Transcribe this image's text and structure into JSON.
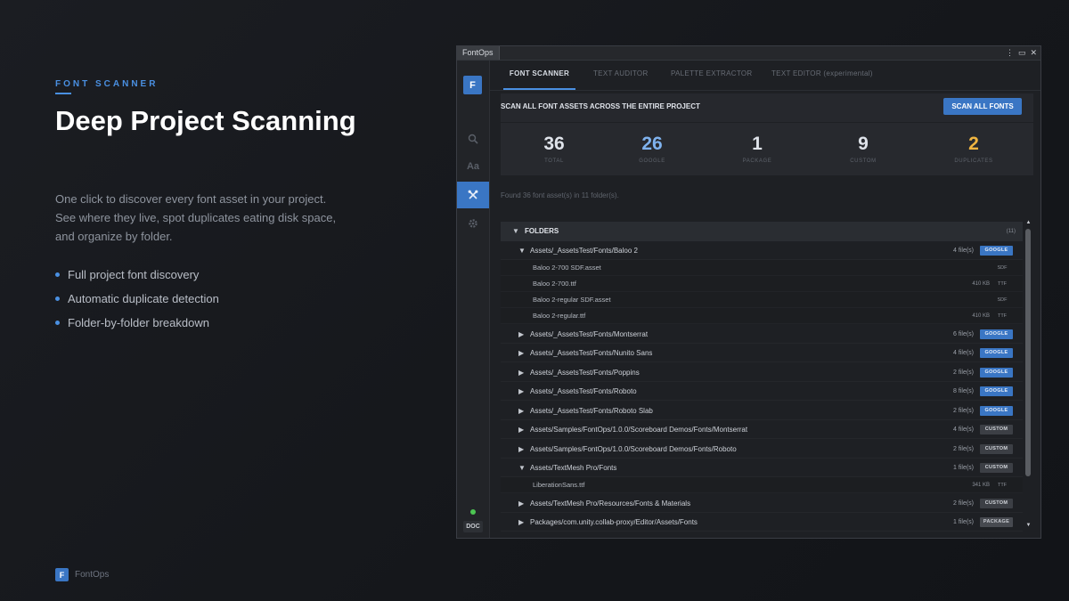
{
  "hero": {
    "eyebrow": "FONT SCANNER",
    "headline": "Deep Project Scanning",
    "description": "One click to discover every font asset in your project. See where they live, spot duplicates eating disk space, and organize by folder.",
    "bullets": [
      "Full project font discovery",
      "Automatic duplicate detection",
      "Folder-by-folder breakdown"
    ]
  },
  "brand": {
    "logo_letter": "F",
    "name": "FontOps"
  },
  "window": {
    "tab_title": "FontOps",
    "controls": [
      "⋮",
      "▭",
      "✕"
    ]
  },
  "sidebar": {
    "logo_letter": "F",
    "icons": [
      "search-icon",
      "text-style-icon",
      "tools-icon",
      "gear-icon"
    ],
    "text_icon_label": "Aa",
    "doc_label": "DOC"
  },
  "tabs": [
    "FONT SCANNER",
    "TEXT AUDITOR",
    "PALETTE EXTRACTOR",
    "TEXT EDITOR (experimental)"
  ],
  "scan": {
    "label": "SCAN ALL FONT ASSETS ACROSS THE ENTIRE PROJECT",
    "button": "SCAN ALL FONTS"
  },
  "stats": [
    {
      "value": "36",
      "label": "TOTAL",
      "color": "#dfe3ea"
    },
    {
      "value": "26",
      "label": "GOOGLE",
      "color": "#7fb2ee"
    },
    {
      "value": "1",
      "label": "PACKAGE",
      "color": "#dfe3ea"
    },
    {
      "value": "9",
      "label": "CUSTOM",
      "color": "#dfe3ea"
    },
    {
      "value": "2",
      "label": "DUPLICATES",
      "color": "#f0b541"
    }
  ],
  "found_text": "Found 36 font asset(s) in 11 folder(s).",
  "folders": {
    "header": "FOLDERS",
    "count": "(11)",
    "rows": [
      {
        "kind": "folder",
        "expanded": true,
        "path": "Assets/_AssetsTest/Fonts/Baloo 2",
        "count": "4 file(s)",
        "badge": "GOOGLE"
      },
      {
        "kind": "file",
        "name": "Baloo 2-700 SDF.asset",
        "size": "",
        "type": "SDF"
      },
      {
        "kind": "file",
        "name": "Baloo 2-700.ttf",
        "size": "410 KB",
        "type": "TTF"
      },
      {
        "kind": "file",
        "name": "Baloo 2-regular SDF.asset",
        "size": "",
        "type": "SDF"
      },
      {
        "kind": "file",
        "name": "Baloo 2-regular.ttf",
        "size": "410 KB",
        "type": "TTF"
      },
      {
        "kind": "folder",
        "expanded": false,
        "path": "Assets/_AssetsTest/Fonts/Montserrat",
        "count": "6 file(s)",
        "badge": "GOOGLE"
      },
      {
        "kind": "folder",
        "expanded": false,
        "path": "Assets/_AssetsTest/Fonts/Nunito Sans",
        "count": "4 file(s)",
        "badge": "GOOGLE"
      },
      {
        "kind": "folder",
        "expanded": false,
        "path": "Assets/_AssetsTest/Fonts/Poppins",
        "count": "2 file(s)",
        "badge": "GOOGLE"
      },
      {
        "kind": "folder",
        "expanded": false,
        "path": "Assets/_AssetsTest/Fonts/Roboto",
        "count": "8 file(s)",
        "badge": "GOOGLE"
      },
      {
        "kind": "folder",
        "expanded": false,
        "path": "Assets/_AssetsTest/Fonts/Roboto Slab",
        "count": "2 file(s)",
        "badge": "GOOGLE"
      },
      {
        "kind": "folder",
        "expanded": false,
        "path": "Assets/Samples/FontOps/1.0.0/Scoreboard Demos/Fonts/Montserrat",
        "count": "4 file(s)",
        "badge": "CUSTOM"
      },
      {
        "kind": "folder",
        "expanded": false,
        "path": "Assets/Samples/FontOps/1.0.0/Scoreboard Demos/Fonts/Roboto",
        "count": "2 file(s)",
        "badge": "CUSTOM"
      },
      {
        "kind": "folder",
        "expanded": true,
        "path": "Assets/TextMesh Pro/Fonts",
        "count": "1 file(s)",
        "badge": "CUSTOM"
      },
      {
        "kind": "file",
        "name": "LiberationSans.ttf",
        "size": "341 KB",
        "type": "TTF"
      },
      {
        "kind": "folder",
        "expanded": false,
        "path": "Assets/TextMesh Pro/Resources/Fonts & Materials",
        "count": "2 file(s)",
        "badge": "CUSTOM"
      },
      {
        "kind": "folder",
        "expanded": false,
        "path": "Packages/com.unity.collab-proxy/Editor/Assets/Fonts",
        "count": "1 file(s)",
        "badge": "PACKAGE"
      }
    ]
  },
  "colors": {
    "accent": "#3a76c4",
    "google_stat": "#7fb2ee",
    "duplicates_stat": "#f0b541",
    "status_ok": "#4cc552"
  }
}
